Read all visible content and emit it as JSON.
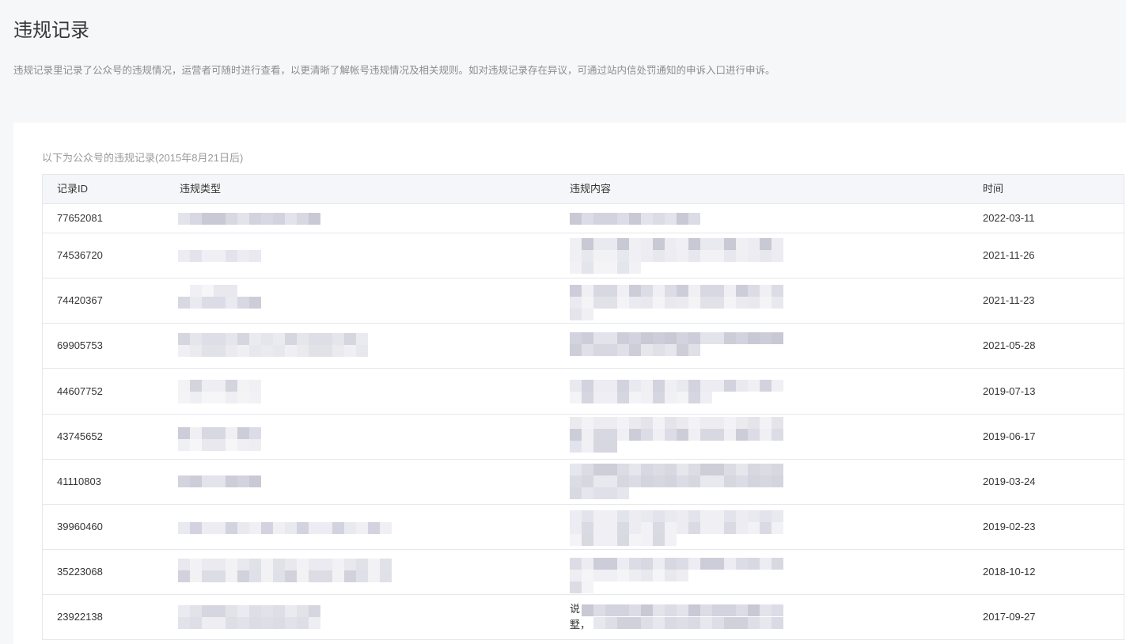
{
  "page": {
    "title": "违规记录",
    "description": "违规记录里记录了公众号的违规情况，运营者可随时进行查看，以更清晰了解帐号违规情况及相关规则。如对违规记录存在异议，可通过站内信处罚通知的申诉入口进行申诉。"
  },
  "records": {
    "caption": "以下为公众号的违规记录(2015年8月21日后)",
    "columns": [
      "记录ID",
      "违规类型",
      "违规内容",
      "时间"
    ],
    "rows": [
      {
        "id": "77652081",
        "time": "2022-03-11"
      },
      {
        "id": "74536720",
        "time": "2021-11-26"
      },
      {
        "id": "74420367",
        "time": "2021-11-23"
      },
      {
        "id": "69905753",
        "time": "2021-05-28"
      },
      {
        "id": "44607752",
        "time": "2019-07-13"
      },
      {
        "id": "43745652",
        "time": "2019-06-17"
      },
      {
        "id": "41110803",
        "time": "2019-03-24"
      },
      {
        "id": "39960460",
        "time": "2019-02-23"
      },
      {
        "id": "35223068",
        "time": "2018-10-12"
      },
      {
        "id": "23922138",
        "content_visible": [
          "说",
          "墅，"
        ],
        "time": "2017-09-27"
      }
    ]
  },
  "colors": {
    "page_background": "#f6f7f9",
    "panel_background": "#ffffff",
    "table_header_background": "#f5f6f9",
    "border": "#e6e7eb",
    "text": "#353535",
    "muted_text": "#8d8d8d",
    "caption_text": "#9a9a9a"
  }
}
